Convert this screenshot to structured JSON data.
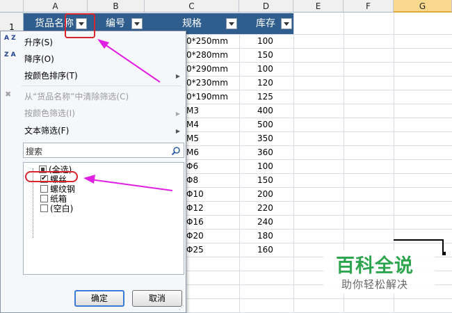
{
  "columns": [
    "A",
    "B",
    "C",
    "D",
    "E",
    "F",
    "G"
  ],
  "row_one": "1",
  "headers": {
    "name": "货品名称",
    "code": "编号",
    "spec": "规格",
    "stock": "库存"
  },
  "spec_values": [
    "0*250mm",
    "0*280mm",
    "0*290mm",
    "0*230mm",
    "0*190mm",
    "M3",
    "M4",
    "M5",
    "M6",
    "Φ6",
    "Φ8",
    "Φ10",
    "Φ12",
    "Φ16",
    "Φ20",
    "Φ25"
  ],
  "stock_values": [
    "100",
    "150",
    "100",
    "120",
    "125",
    "400",
    "500",
    "350",
    "360",
    "100",
    "150",
    "200",
    "220",
    "240",
    "180",
    "160"
  ],
  "menu": {
    "sort_asc": "升序(S)",
    "sort_desc": "降序(O)",
    "sort_color": "按颜色排序(T)",
    "clear_filter": "从“货品名称”中清除筛选(C)",
    "filter_color": "按颜色筛选(I)",
    "text_filter": "文本筛选(F)",
    "search_placeholder": "搜索",
    "icon_az": "A Z",
    "icon_za": "Z A"
  },
  "filter_items": [
    {
      "label": "(全选)",
      "state": "partial"
    },
    {
      "label": "螺丝",
      "state": "checked"
    },
    {
      "label": "螺纹钢",
      "state": "unchecked"
    },
    {
      "label": "纸箱",
      "state": "unchecked"
    },
    {
      "label": "(空白)",
      "state": "unchecked"
    }
  ],
  "buttons": {
    "ok": "确定",
    "cancel": "取消"
  },
  "watermark": {
    "title": "百科全说",
    "subtitle": "助你轻松解决"
  },
  "colors": {
    "header_fill": "#2f5d8e",
    "annotation_red": "#d8242c",
    "arrow_magenta": "#e020e0",
    "watermark_green": "#2da44e"
  }
}
